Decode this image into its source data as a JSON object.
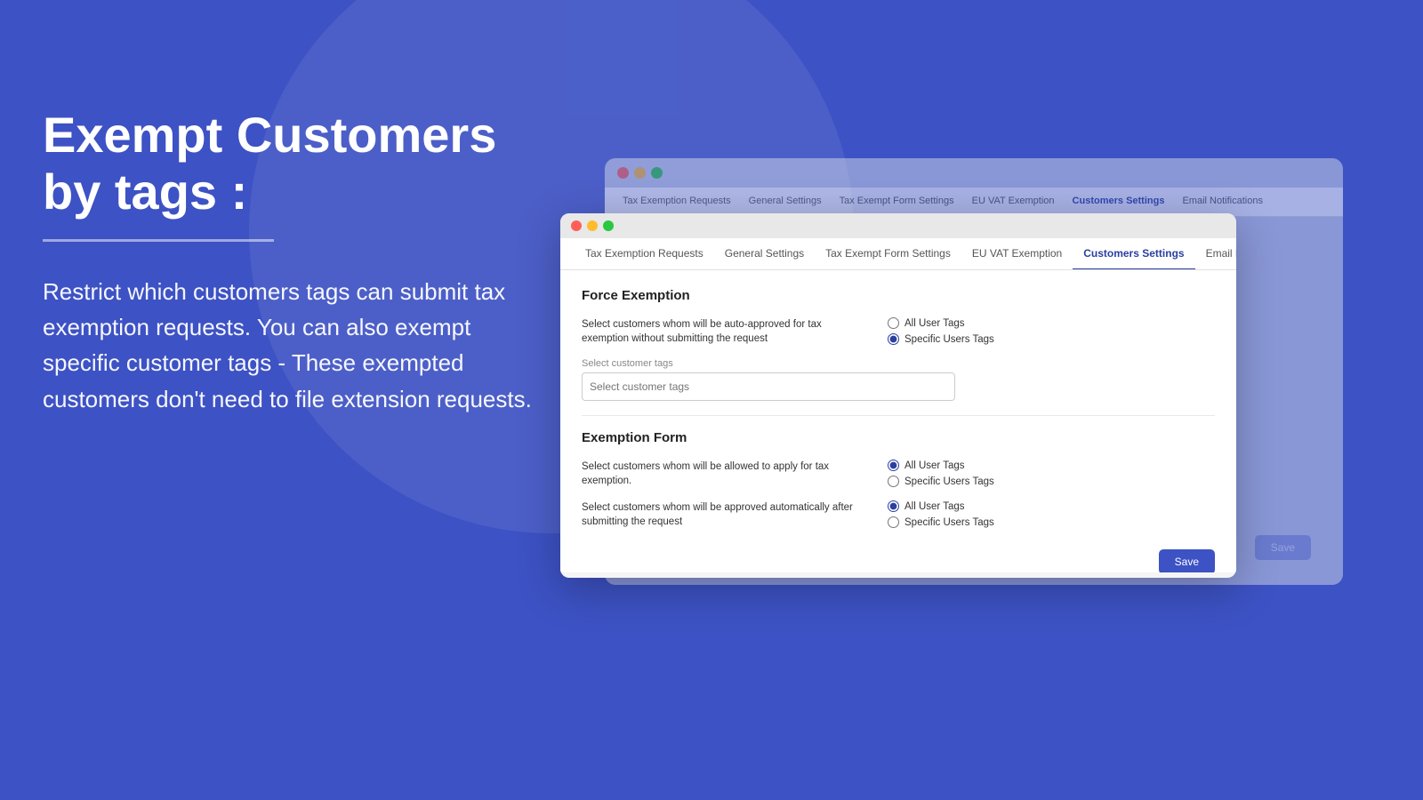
{
  "background": {
    "color": "#3d52c4"
  },
  "left_panel": {
    "heading_line1": "Exempt Customers",
    "heading_line2": "by tags :",
    "description": "Restrict which customers tags can submit tax exemption requests.  You can also exempt specific customer tags - These exempted customers don't need to file extension requests."
  },
  "browser_bg": {
    "dots": [
      "red",
      "yellow",
      "green"
    ],
    "tabs": [
      "Tax Exemption Requests",
      "General Settings",
      "Tax Exempt Form Settings",
      "EU VAT Exemption",
      "Customers Settings",
      "Email Notifications"
    ]
  },
  "browser_fg": {
    "titlebar_dots": [
      "red",
      "yellow",
      "green"
    ],
    "tabs": [
      {
        "label": "Tax Exemption Requests",
        "active": false
      },
      {
        "label": "General Settings",
        "active": false
      },
      {
        "label": "Tax Exempt Form Settings",
        "active": false
      },
      {
        "label": "EU VAT Exemption",
        "active": false
      },
      {
        "label": "Customers Settings",
        "active": true
      },
      {
        "label": "Email Notifications",
        "active": false
      }
    ],
    "force_exemption": {
      "section_title": "Force Exemption",
      "row1_label": "Select customers whom will be auto-approved for tax exemption without submitting the request",
      "row1_options": [
        "All User Tags",
        "Specific Users Tags"
      ],
      "row1_selected": "Specific Users Tags",
      "tag_input_placeholder": "Select customer tags",
      "tag_input_label": "Select customer tags"
    },
    "exemption_form": {
      "section_title": "Exemption Form",
      "row1_label": "Select customers whom will be allowed to apply for tax exemption.",
      "row1_options": [
        "All User Tags",
        "Specific Users Tags"
      ],
      "row1_selected": "All User Tags",
      "row2_label": "Select customers whom will be approved automatically after submitting the request",
      "row2_options": [
        "All User Tags",
        "Specific Users Tags"
      ],
      "row2_selected": "All User Tags"
    },
    "save_button_label": "Save"
  },
  "colors": {
    "accent": "#3d52c4",
    "active_tab_color": "#2a3fa0",
    "dot_red": "#ff5f57",
    "dot_yellow": "#febc2e",
    "dot_green": "#28c840"
  }
}
